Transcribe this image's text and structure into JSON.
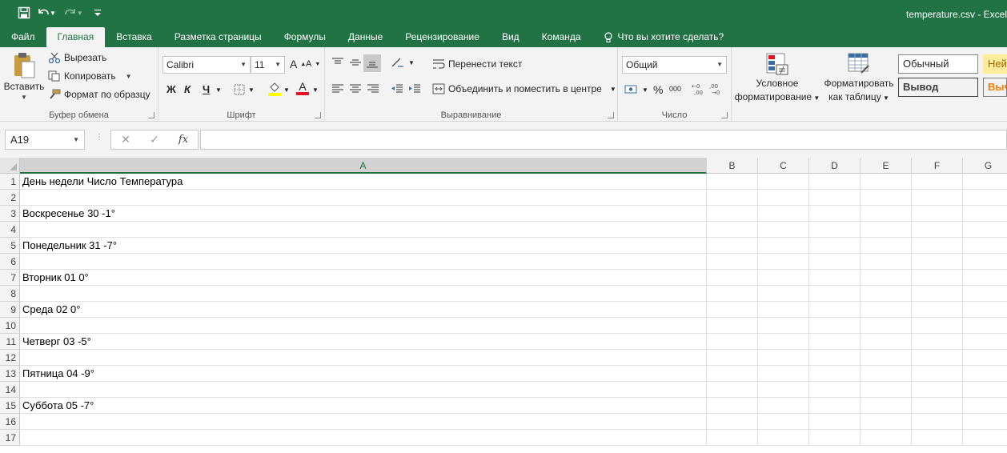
{
  "window": {
    "title": "temperature.csv - Excel"
  },
  "tabs": [
    {
      "label": "Файл"
    },
    {
      "label": "Главная"
    },
    {
      "label": "Вставка"
    },
    {
      "label": "Разметка страницы"
    },
    {
      "label": "Формулы"
    },
    {
      "label": "Данные"
    },
    {
      "label": "Рецензирование"
    },
    {
      "label": "Вид"
    },
    {
      "label": "Команда"
    }
  ],
  "tell_me": "Что вы хотите сделать?",
  "clipboard": {
    "paste": "Вставить",
    "cut": "Вырезать",
    "copy": "Копировать",
    "format_painter": "Формат по образцу",
    "label": "Буфер обмена"
  },
  "font": {
    "name": "Calibri",
    "size": "11",
    "bold": "Ж",
    "italic": "К",
    "underline": "Ч",
    "label": "Шрифт"
  },
  "alignment": {
    "wrap": "Перенести текст",
    "merge": "Объединить и поместить в центре",
    "label": "Выравнивание"
  },
  "number": {
    "format": "Общий",
    "percent": "%",
    "thousands": "000",
    "label": "Число"
  },
  "styles": {
    "conditional": [
      "Условное",
      "форматирование"
    ],
    "as_table": [
      "Форматировать",
      "как таблицу"
    ],
    "normal": "Обычный",
    "output": "Вывод",
    "neutral_partial": "Ней",
    "calc_partial": "Выч"
  },
  "formula_bar": {
    "name_box": "A19",
    "fx": "fx",
    "content": ""
  },
  "sheet": {
    "selected_column": "A",
    "columns": [
      "A",
      "B",
      "C",
      "D",
      "E",
      "F",
      "G"
    ],
    "rows": [
      {
        "n": "1",
        "a": "День недели Число Температура"
      },
      {
        "n": "2",
        "a": ""
      },
      {
        "n": "3",
        "a": "Воскресенье 30 -1°"
      },
      {
        "n": "4",
        "a": ""
      },
      {
        "n": "5",
        "a": "Понедельник 31 -7°"
      },
      {
        "n": "6",
        "a": ""
      },
      {
        "n": "7",
        "a": "Вторник 01 0°"
      },
      {
        "n": "8",
        "a": ""
      },
      {
        "n": "9",
        "a": "Среда 02 0°"
      },
      {
        "n": "10",
        "a": ""
      },
      {
        "n": "11",
        "a": "Четверг 03 -5°"
      },
      {
        "n": "12",
        "a": ""
      },
      {
        "n": "13",
        "a": "Пятница 04 -9°"
      },
      {
        "n": "14",
        "a": ""
      },
      {
        "n": "15",
        "a": "Суббота 05 -7°"
      },
      {
        "n": "16",
        "a": ""
      },
      {
        "n": "17",
        "a": ""
      }
    ]
  },
  "colors": {
    "accent": "#217346",
    "ribbon": "#f3f3f3"
  }
}
